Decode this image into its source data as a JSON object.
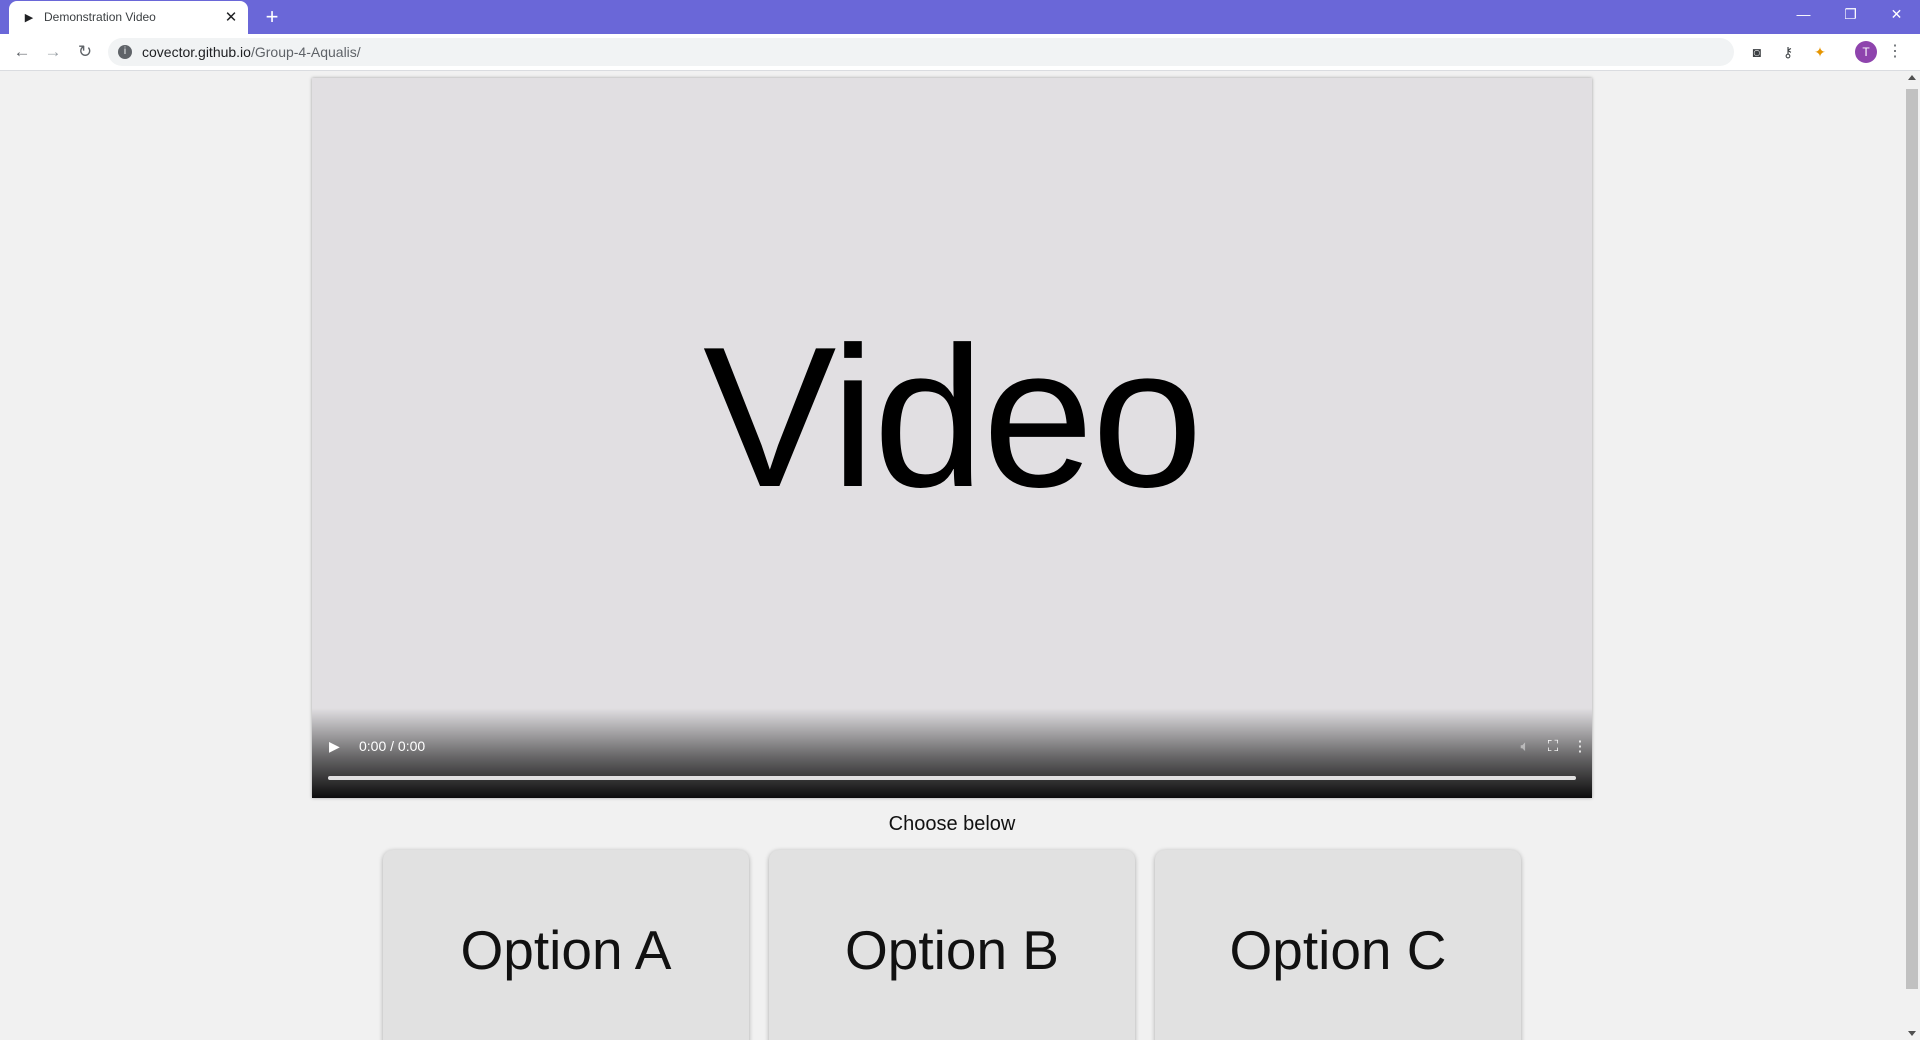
{
  "browser": {
    "tab_title": "Demonstration Video",
    "tab_favicon": "▶",
    "tab_close": "✕",
    "new_tab": "+",
    "url_host": "covector.github.io",
    "url_path": "/Group-4-Aqualis/",
    "avatar_initial": "T",
    "icons": [
      "back-arrow-icon",
      "forward-arrow-icon",
      "reload-icon",
      "site-info-icon",
      "extension-icon",
      "key-icon",
      "extension-puzzle-icon",
      "kebab-menu-icon"
    ],
    "window_controls": {
      "minimize": "—",
      "restore": "❐",
      "close": "✕"
    }
  },
  "video": {
    "placeholder_text": "Video",
    "time_display": "0:00 / 0:00",
    "progress": 0
  },
  "prompt": "Choose below",
  "options": [
    {
      "label": "Option A"
    },
    {
      "label": "Option B"
    },
    {
      "label": "Option C"
    }
  ],
  "colors": {
    "titlebar": "#6a67d8",
    "page_bg": "#f1f1f1",
    "video_bg": "#e1dfe2",
    "option_bg": "#e1e1e1"
  }
}
